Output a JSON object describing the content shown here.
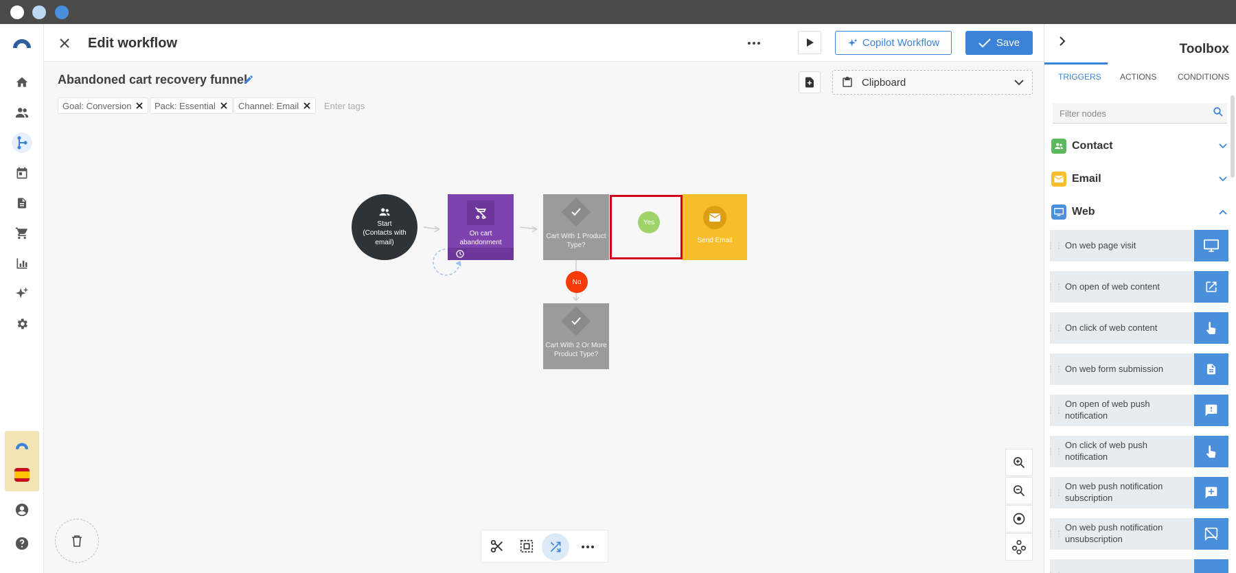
{
  "colors": {
    "accent": "#3b83d8",
    "start_node": "#2e3338",
    "trigger_node": "#7f43b0",
    "condition_node": "#9b9b9b",
    "email_node": "#f7bd2b",
    "yes_badge": "#9ed36a",
    "no_badge": "#f43b08",
    "selection": "#d0021b"
  },
  "header": {
    "title": "Edit workflow",
    "copilot_label": "Copilot Workflow",
    "save_label": "Save"
  },
  "workflow": {
    "name": "Abandoned cart recovery funnel",
    "tags": [
      "Goal: Conversion",
      "Pack: Essential",
      "Channel: Email"
    ],
    "tags_placeholder": "Enter tags",
    "clipboard_label": "Clipboard"
  },
  "nodes": {
    "start": "Start\n(Contacts with\nemail)",
    "trigger": "On cart abandonment",
    "condition1": "Cart With 1 Product\nType?",
    "condition2": "Cart With 2 Or More\nProduct Type?",
    "email": "Send Email",
    "yes": "Yes",
    "no": "No"
  },
  "toolbox": {
    "title": "Toolbox",
    "tabs": [
      "TRIGGERS",
      "ACTIONS",
      "CONDITIONS"
    ],
    "filter_placeholder": "Filter nodes",
    "categories": [
      "Contact",
      "Email",
      "Web"
    ],
    "items": [
      "On web page visit",
      "On open of web content",
      "On click of web content",
      "On web form submission",
      "On open of web push notification",
      "On click of web push notification",
      "On web push notification subscription",
      "On web push notification unsubscription"
    ]
  }
}
